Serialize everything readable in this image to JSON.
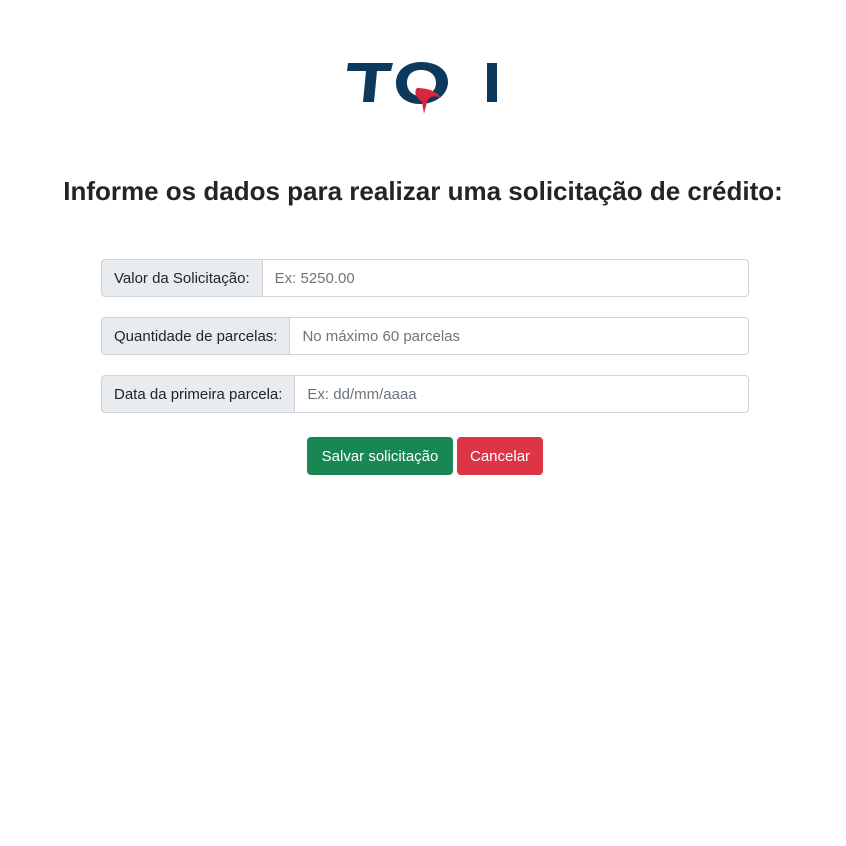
{
  "logo": {
    "text": "TQI",
    "colors": {
      "primary": "#0d3a5c",
      "accent": "#d7263d"
    }
  },
  "page": {
    "heading": "Informe os dados para realizar uma solicitação de crédito:"
  },
  "form": {
    "fields": [
      {
        "label": "Valor da Solicitação:",
        "value": "",
        "placeholder": "Ex: 5250.00"
      },
      {
        "label": "Quantidade de parcelas:",
        "value": "",
        "placeholder": "No máximo 60 parcelas"
      },
      {
        "label": "Data da primeira parcela:",
        "value": "",
        "placeholder": "Ex: dd/mm/aaaa"
      }
    ],
    "buttons": {
      "save_label": "Salvar solicitação",
      "cancel_label": "Cancelar"
    }
  },
  "colors": {
    "save": "#198754",
    "cancel": "#dc3545",
    "addon_bg": "#e9ecef",
    "border": "#ced4da",
    "placeholder": "#6c757d"
  }
}
